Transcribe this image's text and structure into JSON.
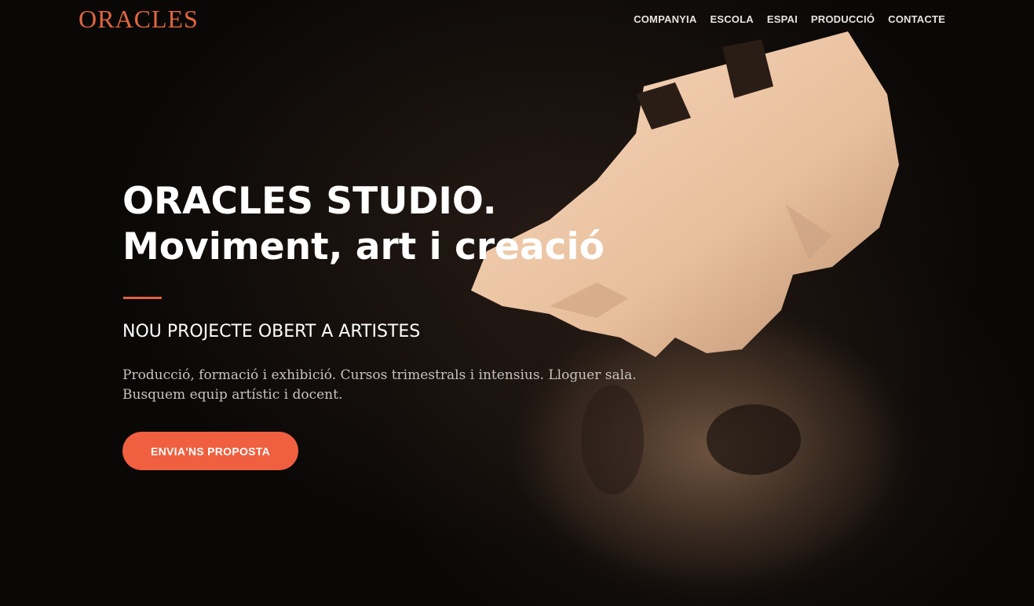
{
  "header": {
    "logo_text": "ORACLES",
    "nav": [
      {
        "label": "COMPANYIA"
      },
      {
        "label": "ESCOLA"
      },
      {
        "label": "ESPAI"
      },
      {
        "label": "PRODUCCIÓ"
      },
      {
        "label": "CONTACTE"
      }
    ]
  },
  "hero": {
    "title_line1": "ORACLES STUDIO.",
    "title_line2": "Moviment, art i creació",
    "subheading": "NOU PROJECTE OBERT A ARTISTES",
    "description_line1": "Producció, formació i exhibició. Cursos trimestrals i intensius. Lloguer sala.",
    "description_line2": "Busquem equip artístic i docent.",
    "cta_label": "ENVIA'NS PROPOSTA"
  },
  "colors": {
    "accent": "#ef5f40",
    "logo": "#e0673f",
    "background": "#0b0807",
    "text_primary": "#ffffff",
    "text_secondary": "#c8c3be"
  }
}
